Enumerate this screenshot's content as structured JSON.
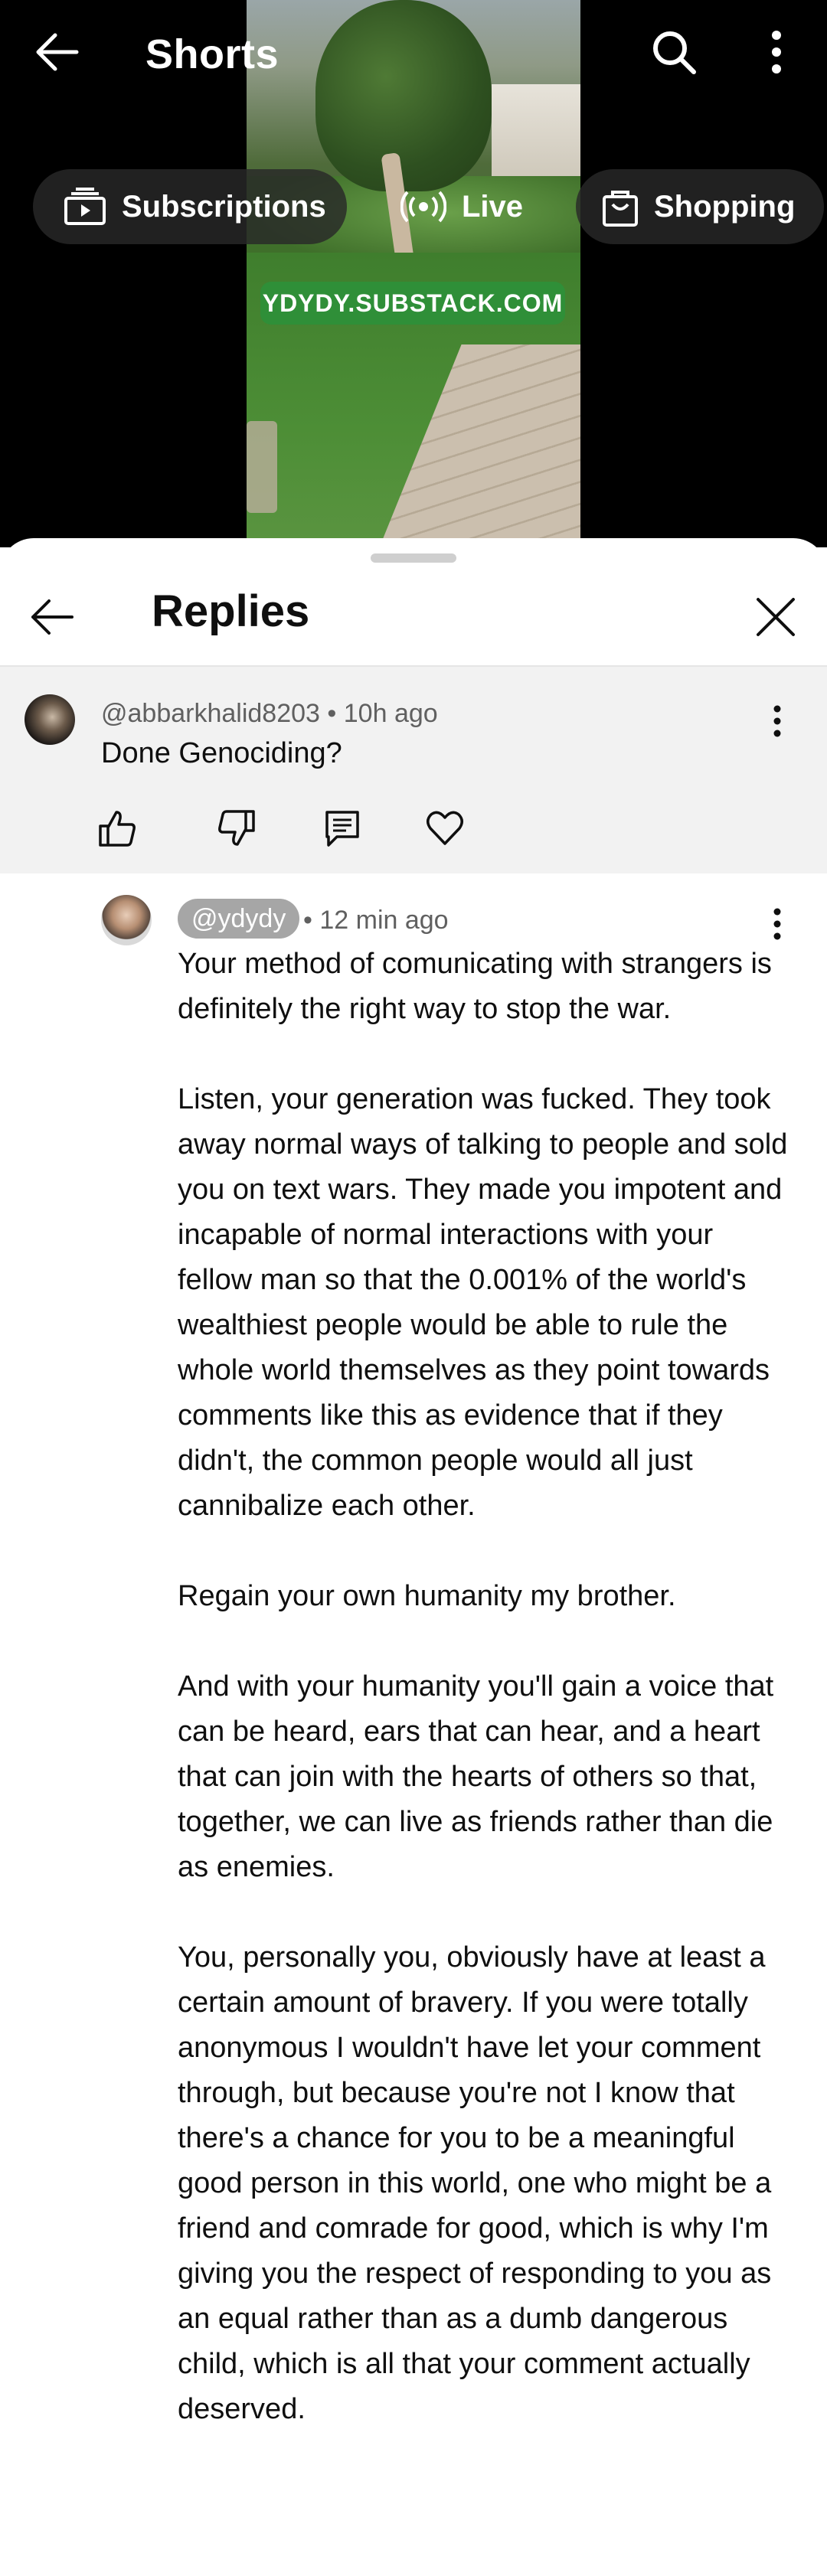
{
  "header": {
    "title": "Shorts"
  },
  "chips": {
    "subscriptions": "Subscriptions",
    "live": "Live",
    "shopping": "Shopping"
  },
  "video": {
    "watermark": "YDYDY.SUBSTACK.COM"
  },
  "sheet": {
    "title": "Replies"
  },
  "parent_comment": {
    "author": "@abbarkhalid8203",
    "time": "10h ago",
    "text": "Done Genociding?"
  },
  "reply": {
    "author": "@ydydy",
    "time": "12 min ago",
    "paragraphs": [
      "Your method of comunicating with strangers is definitely the right way to stop the war.",
      "Listen, your generation was fucked. They took away normal ways of talking to people and sold you on text wars. They made you impotent and incapable of normal interactions with your fellow man so that the 0.001% of the world's wealthiest people would be able to rule the whole world themselves as they point towards comments like this as evidence that if they didn't, the common people would all just cannibalize each other.",
      "Regain your own humanity my brother.",
      "And with your humanity you'll gain a voice that can be heard, ears that can hear, and a heart that can join with the hearts of others so that, together, we can live as friends rather than die as enemies.",
      "You, personally you, obviously have at least a certain amount of bravery. If you were totally anonymous I wouldn't have let your comment through, but because you're not I know that there's a chance for you to be a meaningful good person in this world, one who might be a friend and comrade for good, which is why I'm giving you the respect of responding to you as an equal rather than as a dumb dangerous child, which is all that your comment actually deserved."
    ]
  },
  "icons": {
    "back": "arrow-left-icon",
    "search": "search-icon",
    "more": "more-vert-icon",
    "subscriptions": "subscriptions-icon",
    "live": "live-icon",
    "shopping": "shopping-bag-icon",
    "close": "close-icon",
    "like": "thumb-up-icon",
    "dislike": "thumb-down-icon",
    "reply": "comment-icon",
    "heart": "heart-icon"
  },
  "colors": {
    "watermark_bg": "#2f8f38",
    "handle_chip_bg": "#a6a6a6"
  }
}
